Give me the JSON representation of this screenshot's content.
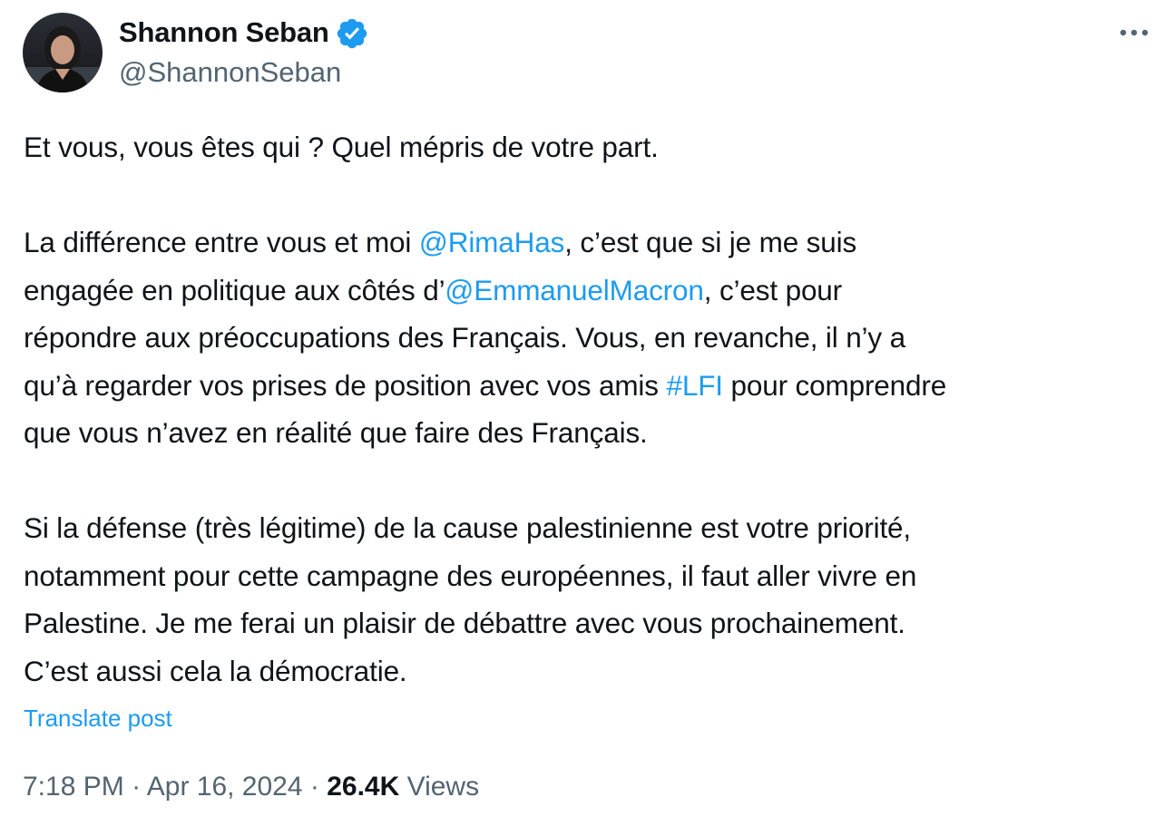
{
  "author": {
    "display_name": "Shannon Seban",
    "handle": "@ShannonSeban",
    "verified_icon": "verified-badge-icon",
    "avatar": "profile-photo"
  },
  "menu": {
    "more_icon": "more-horizontal-icon"
  },
  "post": {
    "p1": "Et vous, vous êtes qui ? Quel mépris de votre part.",
    "p2_l1_a": "La différence entre vous et moi ",
    "mention_rima": "@RimaHas",
    "p2_l1_b": ", c’est que si je me suis",
    "p2_l2_a": "engagée en politique aux côtés d’",
    "mention_macron": "@EmmanuelMacron",
    "p2_l2_b": ", c’est pour",
    "p2_l3": "répondre aux préoccupations des Français. Vous, en revanche, il n’y a",
    "p2_l4_a": "qu’à regarder vos prises de position avec vos amis ",
    "hashtag_lfi": "#LFI",
    "p2_l4_b": " pour comprendre",
    "p2_l5": "que vous n’avez en réalité que faire des Français.",
    "p3_l1": "Si la défense (très légitime) de la cause palestinienne est votre priorité,",
    "p3_l2": "notamment pour cette campagne des européennes, il faut aller vivre en",
    "p3_l3": "Palestine. Je me ferai un plaisir de débattre avec vous prochainement.",
    "p3_l4": "C’est aussi cela la démocratie."
  },
  "translate_label": "Translate post",
  "meta": {
    "time": "7:18 PM",
    "sep1": " · ",
    "date": "Apr 16, 2024",
    "sep2": " · ",
    "views_count": "26.4K",
    "views_label": " Views"
  },
  "colors": {
    "link": "#1d9bf0",
    "text": "#0f1419",
    "secondary": "#536471"
  }
}
